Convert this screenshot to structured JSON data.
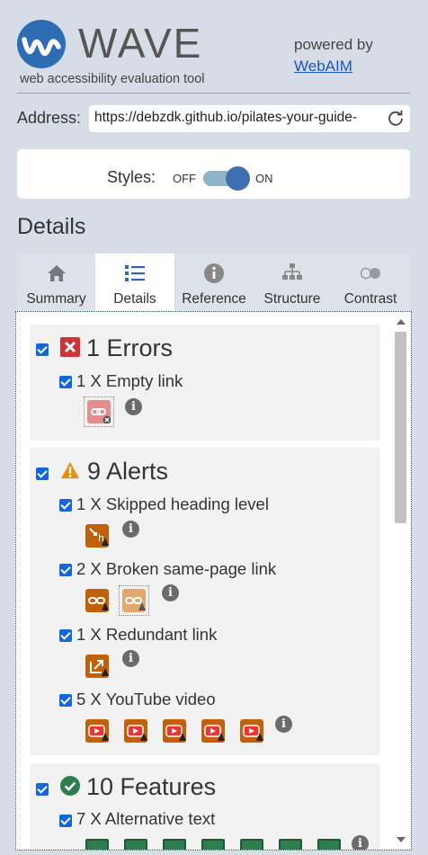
{
  "header": {
    "brand": "WAVE",
    "tagline": "web accessibility evaluation tool",
    "powered_by": "powered by",
    "webaim_link": "WebAIM"
  },
  "address": {
    "label": "Address:",
    "value": "https://debzdk.github.io/pilates-your-guide-"
  },
  "styles": {
    "label": "Styles:",
    "off": "OFF",
    "on": "ON",
    "enabled": true
  },
  "section_title": "Details",
  "tabs": [
    {
      "label": "Summary",
      "icon": "home-icon"
    },
    {
      "label": "Details",
      "icon": "list-icon",
      "active": true
    },
    {
      "label": "Reference",
      "icon": "info-icon"
    },
    {
      "label": "Structure",
      "icon": "hierarchy-icon"
    },
    {
      "label": "Contrast",
      "icon": "contrast-icon"
    }
  ],
  "categories": {
    "errors": {
      "title": "1 Errors",
      "items": [
        {
          "label": "1 X Empty link",
          "icon": "empty-link-icon",
          "count": 1
        }
      ]
    },
    "alerts": {
      "title": "9 Alerts",
      "items": [
        {
          "label": "1 X Skipped heading level",
          "icon": "skipped-heading-icon",
          "count": 1
        },
        {
          "label": "2 X Broken same-page link",
          "icon": "broken-link-icon",
          "count": 2
        },
        {
          "label": "1 X Redundant link",
          "icon": "redundant-link-icon",
          "count": 1
        },
        {
          "label": "5 X YouTube video",
          "icon": "youtube-video-icon",
          "count": 5
        }
      ]
    },
    "features": {
      "title": "10 Features",
      "items": [
        {
          "label": "7 X Alternative text",
          "icon": "alt-text-icon",
          "count": 7
        }
      ]
    }
  },
  "colors": {
    "error": "#d0343a",
    "alert": "#c3610a",
    "feature": "#2e7d4f",
    "accent": "#1467d9"
  }
}
